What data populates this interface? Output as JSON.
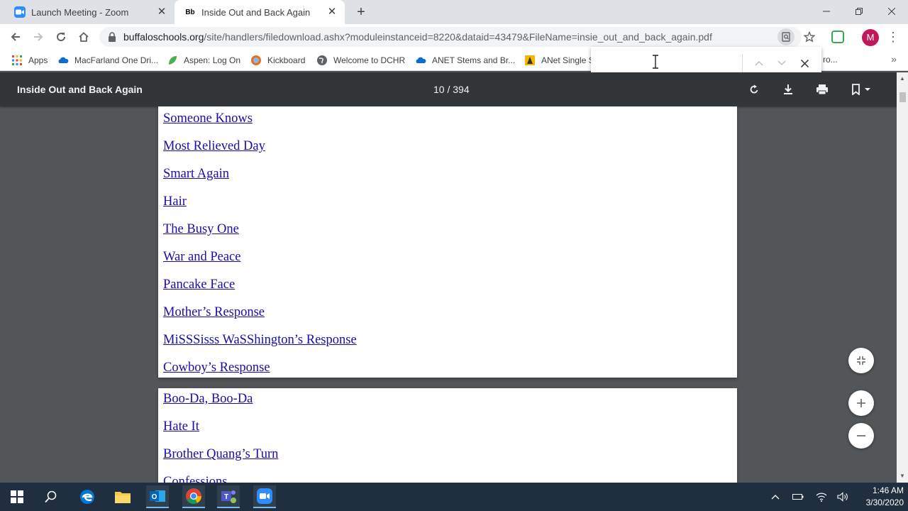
{
  "browser": {
    "tabs": [
      {
        "title": "Launch Meeting - Zoom",
        "favicon": "zoom-icon",
        "active": false
      },
      {
        "title": "Inside Out and Back Again",
        "favicon": "Bb",
        "active": true
      }
    ],
    "url": {
      "host": "buffaloschools.org",
      "path": "/site/handlers/filedownload.ashx?moduleinstanceid=8220&dataid=43479&FileName=insie_out_and_back_again.pdf"
    },
    "profile_initial": "M",
    "bookmarks": [
      {
        "label": "Apps",
        "icon": "apps-grid-icon"
      },
      {
        "label": "MacFarland One Dri...",
        "icon": "onedrive-cloud-icon"
      },
      {
        "label": "Aspen: Log On",
        "icon": "aspen-leaf-icon"
      },
      {
        "label": "Kickboard",
        "icon": "kickboard-icon"
      },
      {
        "label": "Welcome to DCHR",
        "icon": "globe-icon"
      },
      {
        "label": "ANET Stems and Br...",
        "icon": "onedrive-cloud-icon"
      },
      {
        "label": "ANet Single S",
        "icon": "anet-icon"
      },
      {
        "label": "ro...",
        "icon": "bookmark-icon"
      }
    ],
    "find": {
      "value": "",
      "placeholder": ""
    }
  },
  "pdf": {
    "title": "Inside Out and Back Again",
    "page_indicator": "10 / 394",
    "page_a_links": [
      "Someone Knows",
      "Most Relieved Day",
      "Smart Again",
      "Hair",
      "The Busy One",
      "War and Peace",
      "Pancake Face",
      "Mother’s Response",
      "MiSSSisss WaSShington’s Response",
      "Cowboy’s Response"
    ],
    "page_b_links": [
      "Boo-Da, Boo-Da",
      "Hate It",
      "Brother Quang’s Turn",
      "Confessions"
    ]
  },
  "taskbar": {
    "time": "1:46 AM",
    "date": "3/30/2020",
    "apps": [
      "windows-start-icon",
      "search-icon",
      "edge-icon",
      "file-explorer-icon",
      "outlook-icon",
      "chrome-icon",
      "teams-icon",
      "zoom-icon"
    ]
  },
  "colors": {
    "link": "#1a0dab",
    "pdf_toolbar": "#323639",
    "viewer_bg": "#525659",
    "taskbar": "#1f2f3f"
  }
}
